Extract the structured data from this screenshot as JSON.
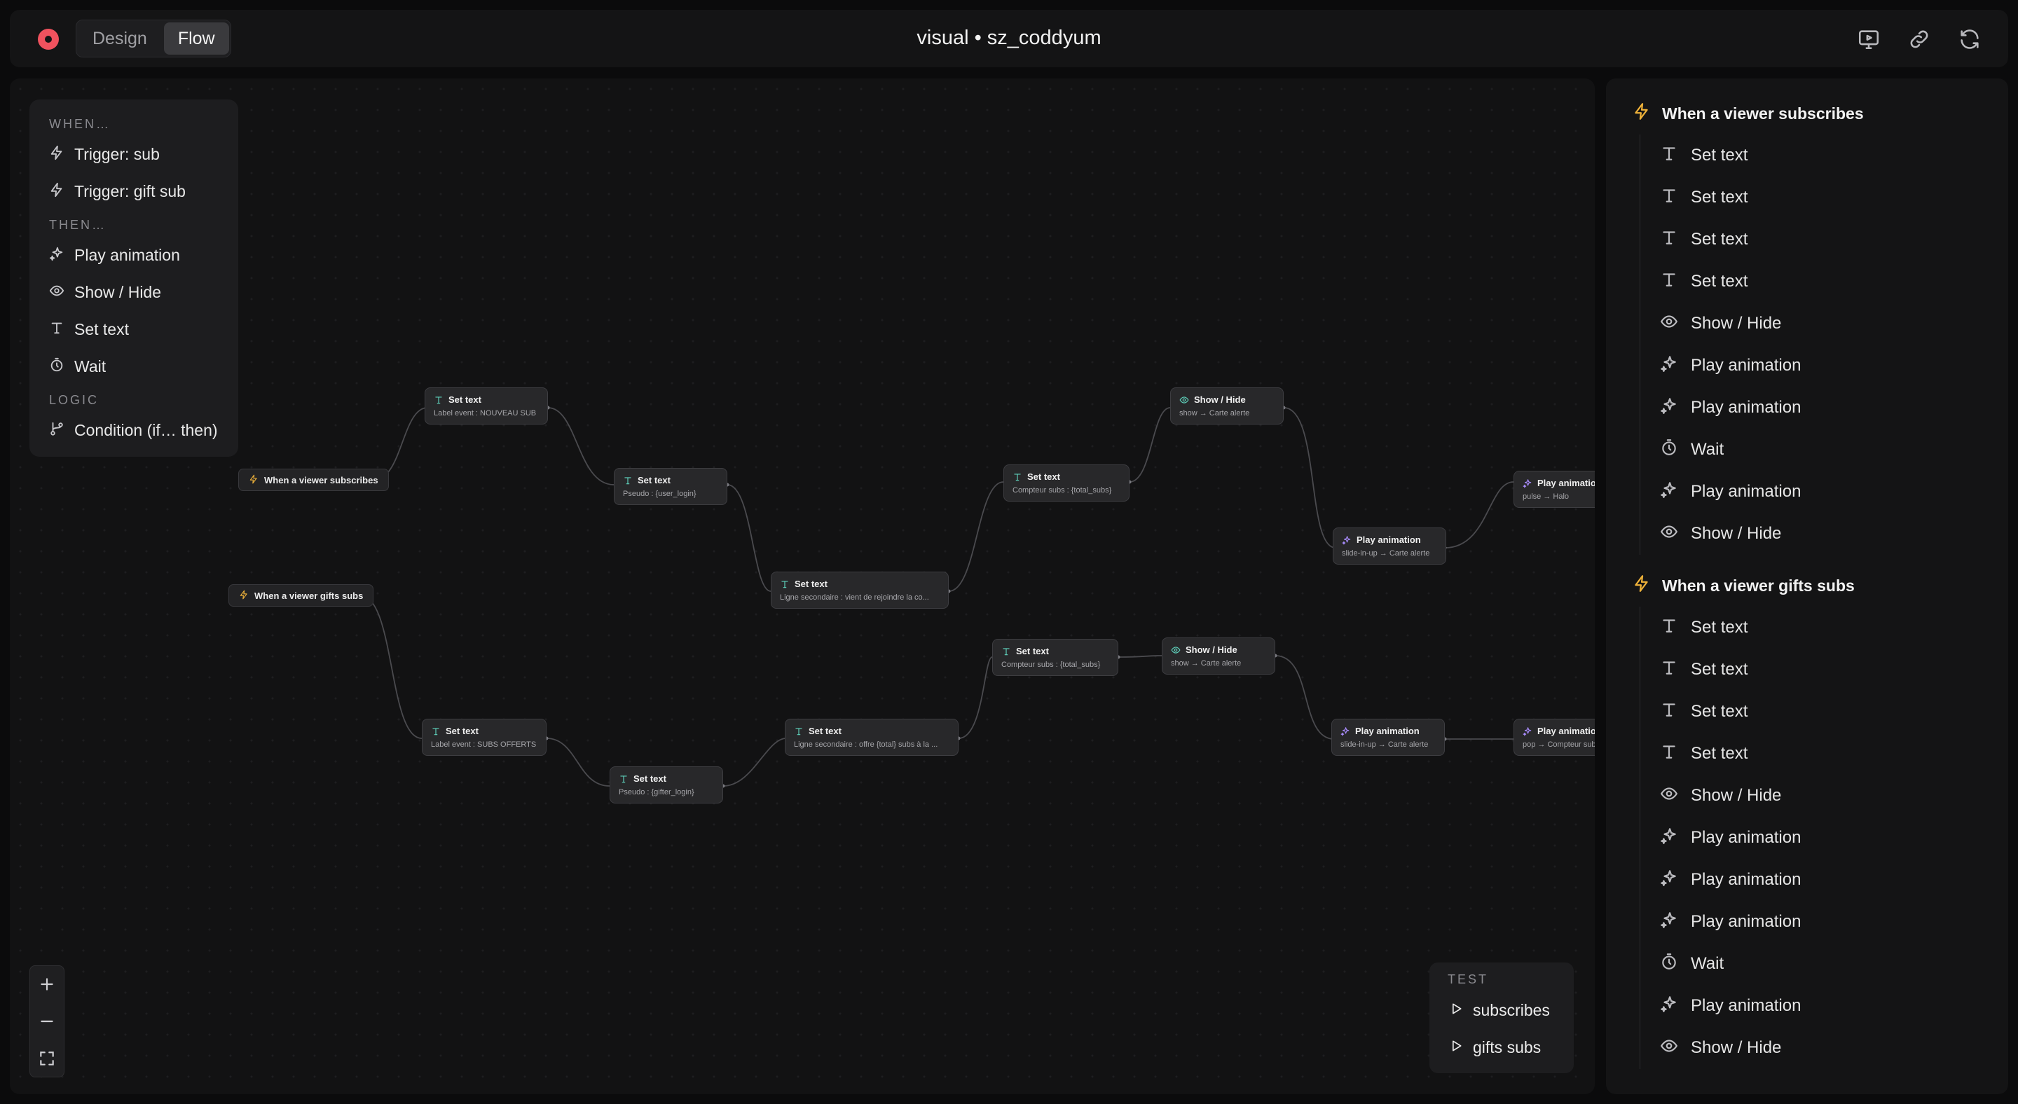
{
  "header": {
    "title": "visual • sz_coddyum",
    "tabs": [
      {
        "label": "Design"
      },
      {
        "label": "Flow"
      }
    ],
    "active_tab": "Flow",
    "icons": [
      "record-icon",
      "monitor-icon",
      "link-icon",
      "refresh-icon"
    ]
  },
  "palette": {
    "sections": [
      {
        "heading": "WHEN…",
        "items": [
          {
            "label": "Trigger: sub",
            "icon": "bolt-icon"
          },
          {
            "label": "Trigger: gift sub",
            "icon": "bolt-icon"
          }
        ]
      },
      {
        "heading": "THEN…",
        "items": [
          {
            "label": "Play animation",
            "icon": "sparkle-icon"
          },
          {
            "label": "Show / Hide",
            "icon": "eye-icon"
          },
          {
            "label": "Set text",
            "icon": "text-icon"
          },
          {
            "label": "Wait",
            "icon": "timer-icon"
          }
        ]
      },
      {
        "heading": "LOGIC",
        "items": [
          {
            "label": "Condition (if… then)",
            "icon": "branch-icon"
          }
        ]
      }
    ]
  },
  "flow": {
    "triggers": [
      {
        "label": "When a viewer subscribes"
      },
      {
        "label": "When a viewer gifts subs"
      }
    ],
    "nodes": [
      {
        "title": "Set text",
        "sub": "Label event : NOUVEAU SUB",
        "kind": "text"
      },
      {
        "title": "Set text",
        "sub": "Pseudo : {user_login}",
        "kind": "text"
      },
      {
        "title": "Set text",
        "sub": "Ligne secondaire : vient de rejoindre la co...",
        "kind": "text"
      },
      {
        "title": "Set text",
        "sub": "Compteur subs : {total_subs}",
        "kind": "text"
      },
      {
        "title": "Show / Hide",
        "sub": "show → Carte alerte",
        "kind": "eye"
      },
      {
        "title": "Play animation",
        "sub": "slide-in-up → Carte alerte",
        "kind": "anim"
      },
      {
        "title": "Play animation",
        "sub": "pulse → Halo",
        "kind": "anim"
      },
      {
        "title": "Set text",
        "sub": "Label event : SUBS OFFERTS",
        "kind": "text"
      },
      {
        "title": "Set text",
        "sub": "Pseudo : {gifter_login}",
        "kind": "text"
      },
      {
        "title": "Set text",
        "sub": "Ligne secondaire : offre {total} subs à la ...",
        "kind": "text"
      },
      {
        "title": "Set text",
        "sub": "Compteur subs : {total_subs}",
        "kind": "text"
      },
      {
        "title": "Show / Hide",
        "sub": "show → Carte alerte",
        "kind": "eye"
      },
      {
        "title": "Play animation",
        "sub": "slide-in-up → Carte alerte",
        "kind": "anim"
      },
      {
        "title": "Play animation",
        "sub": "pop → Compteur subs",
        "kind": "anim"
      }
    ]
  },
  "zoom": {
    "icons": [
      "zoom-in-icon",
      "zoom-out-icon",
      "fit-view-icon"
    ]
  },
  "test": {
    "heading": "TEST",
    "items": [
      {
        "label": "subscribes"
      },
      {
        "label": "gifts subs"
      }
    ]
  },
  "outline": {
    "groups": [
      {
        "title": "When a viewer subscribes",
        "items": [
          {
            "label": "Set text",
            "icon": "text-icon"
          },
          {
            "label": "Set text",
            "icon": "text-icon"
          },
          {
            "label": "Set text",
            "icon": "text-icon"
          },
          {
            "label": "Set text",
            "icon": "text-icon"
          },
          {
            "label": "Show / Hide",
            "icon": "eye-icon"
          },
          {
            "label": "Play animation",
            "icon": "sparkle-icon"
          },
          {
            "label": "Play animation",
            "icon": "sparkle-icon"
          },
          {
            "label": "Wait",
            "icon": "timer-icon"
          },
          {
            "label": "Play animation",
            "icon": "sparkle-icon"
          },
          {
            "label": "Show / Hide",
            "icon": "eye-icon"
          }
        ]
      },
      {
        "title": "When a viewer gifts subs",
        "items": [
          {
            "label": "Set text",
            "icon": "text-icon"
          },
          {
            "label": "Set text",
            "icon": "text-icon"
          },
          {
            "label": "Set text",
            "icon": "text-icon"
          },
          {
            "label": "Set text",
            "icon": "text-icon"
          },
          {
            "label": "Show / Hide",
            "icon": "eye-icon"
          },
          {
            "label": "Play animation",
            "icon": "sparkle-icon"
          },
          {
            "label": "Play animation",
            "icon": "sparkle-icon"
          },
          {
            "label": "Play animation",
            "icon": "sparkle-icon"
          },
          {
            "label": "Wait",
            "icon": "timer-icon"
          },
          {
            "label": "Play animation",
            "icon": "sparkle-icon"
          },
          {
            "label": "Show / Hide",
            "icon": "eye-icon"
          }
        ]
      }
    ]
  },
  "colors": {
    "accent_record": "#f0525e",
    "trigger_bolt": "#f0b33a",
    "text_node": "#5fd3bd",
    "animation_node": "#a78bfa"
  }
}
